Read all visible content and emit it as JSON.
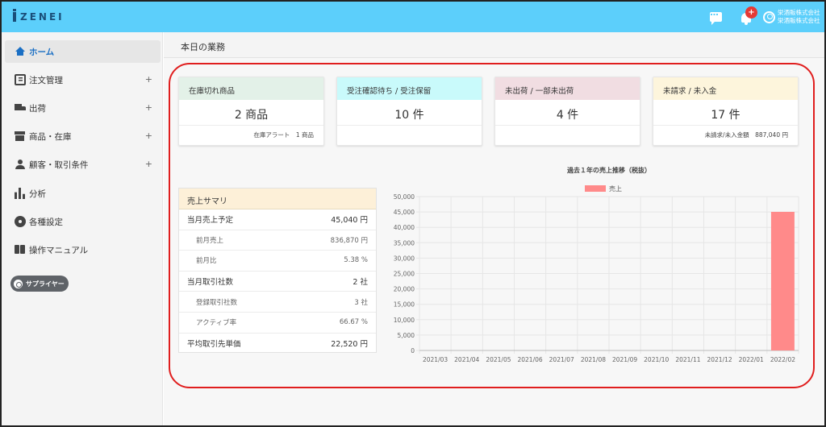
{
  "header": {
    "logo_text": "ZENEI",
    "badge_text": "+",
    "company_line1": "栄酒販株式会社",
    "company_line2": "栄酒販株式会社",
    "accent_color": "#5ccffb"
  },
  "sidebar": {
    "items": [
      {
        "label": "ホーム",
        "icon": "home-icon",
        "active": true,
        "expandable": false
      },
      {
        "label": "注文管理",
        "icon": "order-icon",
        "expandable": true
      },
      {
        "label": "出荷",
        "icon": "truck-icon",
        "expandable": true
      },
      {
        "label": "商品・在庫",
        "icon": "inventory-box-icon",
        "expandable": true
      },
      {
        "label": "顧客・取引条件",
        "icon": "person-icon",
        "expandable": true
      },
      {
        "label": "分析",
        "icon": "bar-chart-icon",
        "expandable": false
      },
      {
        "label": "各種設定",
        "icon": "gear-icon",
        "expandable": false
      },
      {
        "label": "操作マニュアル",
        "icon": "book-icon",
        "expandable": false
      }
    ],
    "expand_symbol": "+",
    "supplier_button": "サプライヤー"
  },
  "main": {
    "page_title": "本日の業務",
    "kpis": [
      {
        "title": "在庫切れ商品",
        "value": "2 商品",
        "footer": "在庫アラート　1 商品",
        "color": "#e3f1e8"
      },
      {
        "title": "受注確認待ち / 受注保留",
        "value": "10 件",
        "footer": "",
        "color": "#c9fafb"
      },
      {
        "title": "未出荷 / 一部未出荷",
        "value": "4 件",
        "footer": "",
        "color": "#f1dde2"
      },
      {
        "title": "未請求 / 未入金",
        "value": "17 件",
        "footer": "未請求/未入金額　887,040 円",
        "color": "#fdf5dc"
      }
    ],
    "summary": {
      "title": "売上サマリ",
      "rows": [
        {
          "label": "当月売上予定",
          "value": "45,040 円",
          "sub": false
        },
        {
          "label": "前月売上",
          "value": "836,870 円",
          "sub": true
        },
        {
          "label": "前月比",
          "value": "5.38 %",
          "sub": true
        },
        {
          "label": "当月取引社数",
          "value": "2 社",
          "sub": false
        },
        {
          "label": "登録取引社数",
          "value": "3 社",
          "sub": true
        },
        {
          "label": "アクティブ率",
          "value": "66.67 %",
          "sub": true
        },
        {
          "label": "平均取引先単価",
          "value": "22,520 円",
          "sub": false
        }
      ]
    }
  },
  "chart_data": {
    "type": "bar",
    "title": "過去１年の売上推移（税抜）",
    "categories": [
      "2021/03",
      "2021/04",
      "2021/05",
      "2021/06",
      "2021/07",
      "2021/08",
      "2021/09",
      "2021/10",
      "2021/11",
      "2021/12",
      "2022/01",
      "2022/02"
    ],
    "series": [
      {
        "name": "売上",
        "color": "#ff8a8a",
        "values": [
          0,
          0,
          0,
          0,
          0,
          0,
          0,
          0,
          0,
          0,
          0,
          45040
        ]
      }
    ],
    "ylim": [
      0,
      50000
    ],
    "yticks": [
      0,
      5000,
      10000,
      15000,
      20000,
      25000,
      30000,
      35000,
      40000,
      45000,
      50000
    ],
    "grid": true,
    "legend": "top"
  }
}
